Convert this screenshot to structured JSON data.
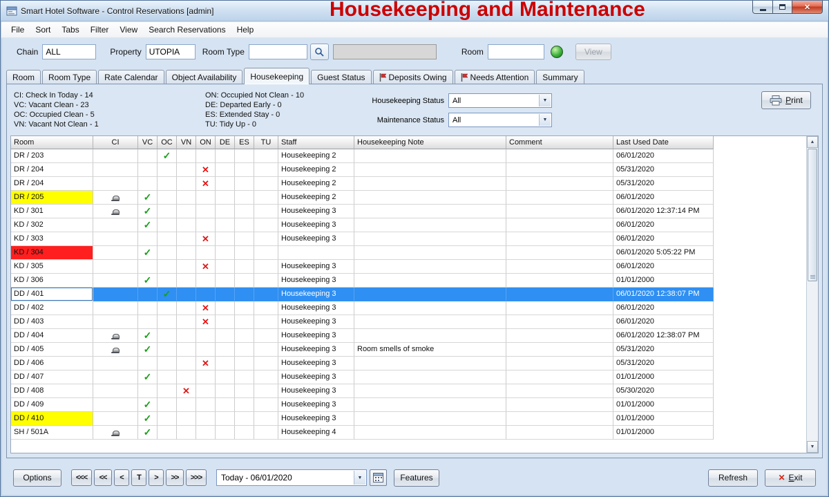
{
  "window": {
    "title": "Smart Hotel Software - Control Reservations [admin]",
    "overlay_title": "Housekeeping and Maintenance"
  },
  "menu": {
    "items": [
      "File",
      "Sort",
      "Tabs",
      "Filter",
      "View",
      "Search Reservations",
      "Help"
    ]
  },
  "toolbar": {
    "chain_label": "Chain",
    "chain_value": "ALL",
    "property_label": "Property",
    "property_value": "UTOPIA",
    "room_type_label": "Room Type",
    "room_type_value": "",
    "room_label": "Room",
    "room_value": "",
    "view_button": "View"
  },
  "tabs": [
    {
      "label": "Room",
      "active": false,
      "flag": false
    },
    {
      "label": "Room Type",
      "active": false,
      "flag": false
    },
    {
      "label": "Rate Calendar",
      "active": false,
      "flag": false
    },
    {
      "label": "Object Availability",
      "active": false,
      "flag": false
    },
    {
      "label": "Housekeeping",
      "active": true,
      "flag": false
    },
    {
      "label": "Guest Status",
      "active": false,
      "flag": false
    },
    {
      "label": "Deposits Owing",
      "active": false,
      "flag": true
    },
    {
      "label": "Needs Attention",
      "active": false,
      "flag": true
    },
    {
      "label": "Summary",
      "active": false,
      "flag": false
    }
  ],
  "legend": {
    "left": [
      "CI: Check In Today - 14",
      "VC: Vacant Clean - 23",
      "OC: Occupied Clean - 5",
      "VN: Vacant Not Clean - 1"
    ],
    "right": [
      "ON: Occupied Not Clean - 10",
      "DE: Departed Early - 0",
      "ES: Extended Stay - 0",
      "TU: Tidy Up - 0"
    ]
  },
  "filters": {
    "housekeeping_label": "Housekeeping Status",
    "housekeeping_value": "All",
    "maintenance_label": "Maintenance Status",
    "maintenance_value": "All"
  },
  "print_button": "Print",
  "colors": {
    "heading_red": "#cc0000",
    "selected_row": "#2f8ff2",
    "highlight_yellow": "#ffff00",
    "highlight_red": "#ff1f1f",
    "check_green": "#18a018",
    "x_red": "#e01818"
  },
  "table": {
    "columns": [
      "Room",
      "CI",
      "VC",
      "OC",
      "VN",
      "ON",
      "DE",
      "ES",
      "TU",
      "Staff",
      "Housekeeping Note",
      "Comment",
      "Last Used Date"
    ],
    "rows": [
      {
        "room": "DR / 203",
        "highlight": "",
        "selected": false,
        "ci": "",
        "vc": "",
        "oc": "check",
        "vn": "",
        "on": "",
        "de": "",
        "es": "",
        "tu": "",
        "staff": "Housekeeping 2",
        "note": "",
        "comment": "",
        "last_used": "06/01/2020"
      },
      {
        "room": "DR / 204",
        "highlight": "",
        "selected": false,
        "ci": "",
        "vc": "",
        "oc": "",
        "vn": "",
        "on": "x",
        "de": "",
        "es": "",
        "tu": "",
        "staff": "Housekeeping 2",
        "note": "",
        "comment": "",
        "last_used": "05/31/2020"
      },
      {
        "room": "DR / 204",
        "highlight": "",
        "selected": false,
        "ci": "",
        "vc": "",
        "oc": "",
        "vn": "",
        "on": "x",
        "de": "",
        "es": "",
        "tu": "",
        "staff": "Housekeeping 2",
        "note": "",
        "comment": "",
        "last_used": "05/31/2020"
      },
      {
        "room": "DR / 205",
        "highlight": "yellow",
        "selected": false,
        "ci": "bell",
        "vc": "check",
        "oc": "",
        "vn": "",
        "on": "",
        "de": "",
        "es": "",
        "tu": "",
        "staff": "Housekeeping 2",
        "note": "",
        "comment": "",
        "last_used": "06/01/2020"
      },
      {
        "room": "KD / 301",
        "highlight": "",
        "selected": false,
        "ci": "bell",
        "vc": "check",
        "oc": "",
        "vn": "",
        "on": "",
        "de": "",
        "es": "",
        "tu": "",
        "staff": "Housekeeping 3",
        "note": "",
        "comment": "",
        "last_used": "06/01/2020 12:37:14 PM"
      },
      {
        "room": "KD / 302",
        "highlight": "",
        "selected": false,
        "ci": "",
        "vc": "check",
        "oc": "",
        "vn": "",
        "on": "",
        "de": "",
        "es": "",
        "tu": "",
        "staff": "Housekeeping 3",
        "note": "",
        "comment": "",
        "last_used": "06/01/2020"
      },
      {
        "room": "KD / 303",
        "highlight": "",
        "selected": false,
        "ci": "",
        "vc": "",
        "oc": "",
        "vn": "",
        "on": "x",
        "de": "",
        "es": "",
        "tu": "",
        "staff": "Housekeeping 3",
        "note": "",
        "comment": "",
        "last_used": "06/01/2020"
      },
      {
        "room": "KD / 304",
        "highlight": "red",
        "selected": false,
        "ci": "",
        "vc": "check",
        "oc": "",
        "vn": "",
        "on": "",
        "de": "",
        "es": "",
        "tu": "",
        "staff": "",
        "note": "",
        "comment": "",
        "last_used": "06/01/2020 5:05:22 PM"
      },
      {
        "room": "KD / 305",
        "highlight": "",
        "selected": false,
        "ci": "",
        "vc": "",
        "oc": "",
        "vn": "",
        "on": "x",
        "de": "",
        "es": "",
        "tu": "",
        "staff": "Housekeeping 3",
        "note": "",
        "comment": "",
        "last_used": "06/01/2020"
      },
      {
        "room": "KD / 306",
        "highlight": "",
        "selected": false,
        "ci": "",
        "vc": "check",
        "oc": "",
        "vn": "",
        "on": "",
        "de": "",
        "es": "",
        "tu": "",
        "staff": "Housekeeping 3",
        "note": "",
        "comment": "",
        "last_used": "01/01/2000"
      },
      {
        "room": "DD / 401",
        "highlight": "",
        "selected": true,
        "ci": "",
        "vc": "",
        "oc": "check",
        "vn": "",
        "on": "",
        "de": "",
        "es": "",
        "tu": "",
        "staff": "Housekeeping 3",
        "note": "",
        "comment": "",
        "last_used": "06/01/2020 12:38:07 PM"
      },
      {
        "room": "DD / 402",
        "highlight": "",
        "selected": false,
        "ci": "",
        "vc": "",
        "oc": "",
        "vn": "",
        "on": "x",
        "de": "",
        "es": "",
        "tu": "",
        "staff": "Housekeeping 3",
        "note": "",
        "comment": "",
        "last_used": "06/01/2020"
      },
      {
        "room": "DD / 403",
        "highlight": "",
        "selected": false,
        "ci": "",
        "vc": "",
        "oc": "",
        "vn": "",
        "on": "x",
        "de": "",
        "es": "",
        "tu": "",
        "staff": "Housekeeping 3",
        "note": "",
        "comment": "",
        "last_used": "06/01/2020"
      },
      {
        "room": "DD / 404",
        "highlight": "",
        "selected": false,
        "ci": "bell",
        "vc": "check",
        "oc": "",
        "vn": "",
        "on": "",
        "de": "",
        "es": "",
        "tu": "",
        "staff": "Housekeeping 3",
        "note": "",
        "comment": "",
        "last_used": "06/01/2020 12:38:07 PM"
      },
      {
        "room": "DD / 405",
        "highlight": "",
        "selected": false,
        "ci": "bell",
        "vc": "check",
        "oc": "",
        "vn": "",
        "on": "",
        "de": "",
        "es": "",
        "tu": "",
        "staff": "Housekeeping 3",
        "note": "Room smells of smoke",
        "comment": "",
        "last_used": "05/31/2020"
      },
      {
        "room": "DD / 406",
        "highlight": "",
        "selected": false,
        "ci": "",
        "vc": "",
        "oc": "",
        "vn": "",
        "on": "x",
        "de": "",
        "es": "",
        "tu": "",
        "staff": "Housekeeping 3",
        "note": "",
        "comment": "",
        "last_used": "05/31/2020"
      },
      {
        "room": "DD / 407",
        "highlight": "",
        "selected": false,
        "ci": "",
        "vc": "check",
        "oc": "",
        "vn": "",
        "on": "",
        "de": "",
        "es": "",
        "tu": "",
        "staff": "Housekeeping 3",
        "note": "",
        "comment": "",
        "last_used": "01/01/2000"
      },
      {
        "room": "DD / 408",
        "highlight": "",
        "selected": false,
        "ci": "",
        "vc": "",
        "oc": "",
        "vn": "x",
        "on": "",
        "de": "",
        "es": "",
        "tu": "",
        "staff": "Housekeeping 3",
        "note": "",
        "comment": "",
        "last_used": "05/30/2020"
      },
      {
        "room": "DD / 409",
        "highlight": "",
        "selected": false,
        "ci": "",
        "vc": "check",
        "oc": "",
        "vn": "",
        "on": "",
        "de": "",
        "es": "",
        "tu": "",
        "staff": "Housekeeping 3",
        "note": "",
        "comment": "",
        "last_used": "01/01/2000"
      },
      {
        "room": "DD / 410",
        "highlight": "yellow",
        "selected": false,
        "ci": "",
        "vc": "check",
        "oc": "",
        "vn": "",
        "on": "",
        "de": "",
        "es": "",
        "tu": "",
        "staff": "Housekeeping 3",
        "note": "",
        "comment": "",
        "last_used": "01/01/2000"
      },
      {
        "room": "SH / 501A",
        "highlight": "",
        "selected": false,
        "ci": "bell",
        "vc": "check",
        "oc": "",
        "vn": "",
        "on": "",
        "de": "",
        "es": "",
        "tu": "",
        "staff": "Housekeeping 4",
        "note": "",
        "comment": "",
        "last_used": "01/01/2000"
      }
    ]
  },
  "bottom": {
    "options_label": "Options",
    "nav": [
      "<<<",
      "<<",
      "<",
      "T",
      ">",
      ">>",
      ">>>"
    ],
    "date_value": "Today - 06/01/2020",
    "features_label": "Features",
    "refresh_label": "Refresh",
    "exit_label": "Exit"
  }
}
